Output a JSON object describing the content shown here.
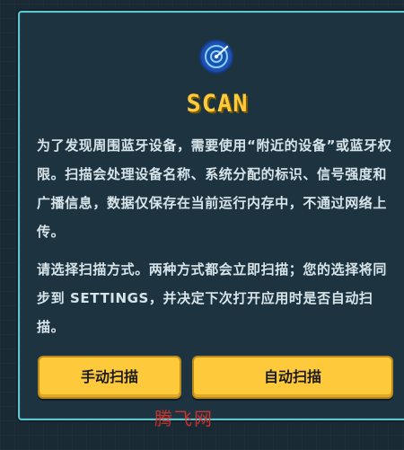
{
  "dialog": {
    "title": "SCAN",
    "icon": "radar-icon",
    "description_1": "为了发现周围蓝牙设备，需要使用“附近的设备”或蓝牙权限。扫描会处理设备名称、系统分配的标识、信号强度和广播信息，数据仅保存在当前运行内存中，不通过网络上传。",
    "description_2": "请选择扫描方式。两种方式都会立即扫描；您的选择将同步到 SETTINGS，并决定下次打开应用时是否自动扫描。",
    "buttons": {
      "manual": "手动扫描",
      "auto": "自动扫描"
    }
  },
  "watermark": "腾飞网",
  "colors": {
    "accent": "#ffc93c",
    "border": "#5fc6cf",
    "panel": "#1d3440",
    "text": "#d7e4ea"
  }
}
